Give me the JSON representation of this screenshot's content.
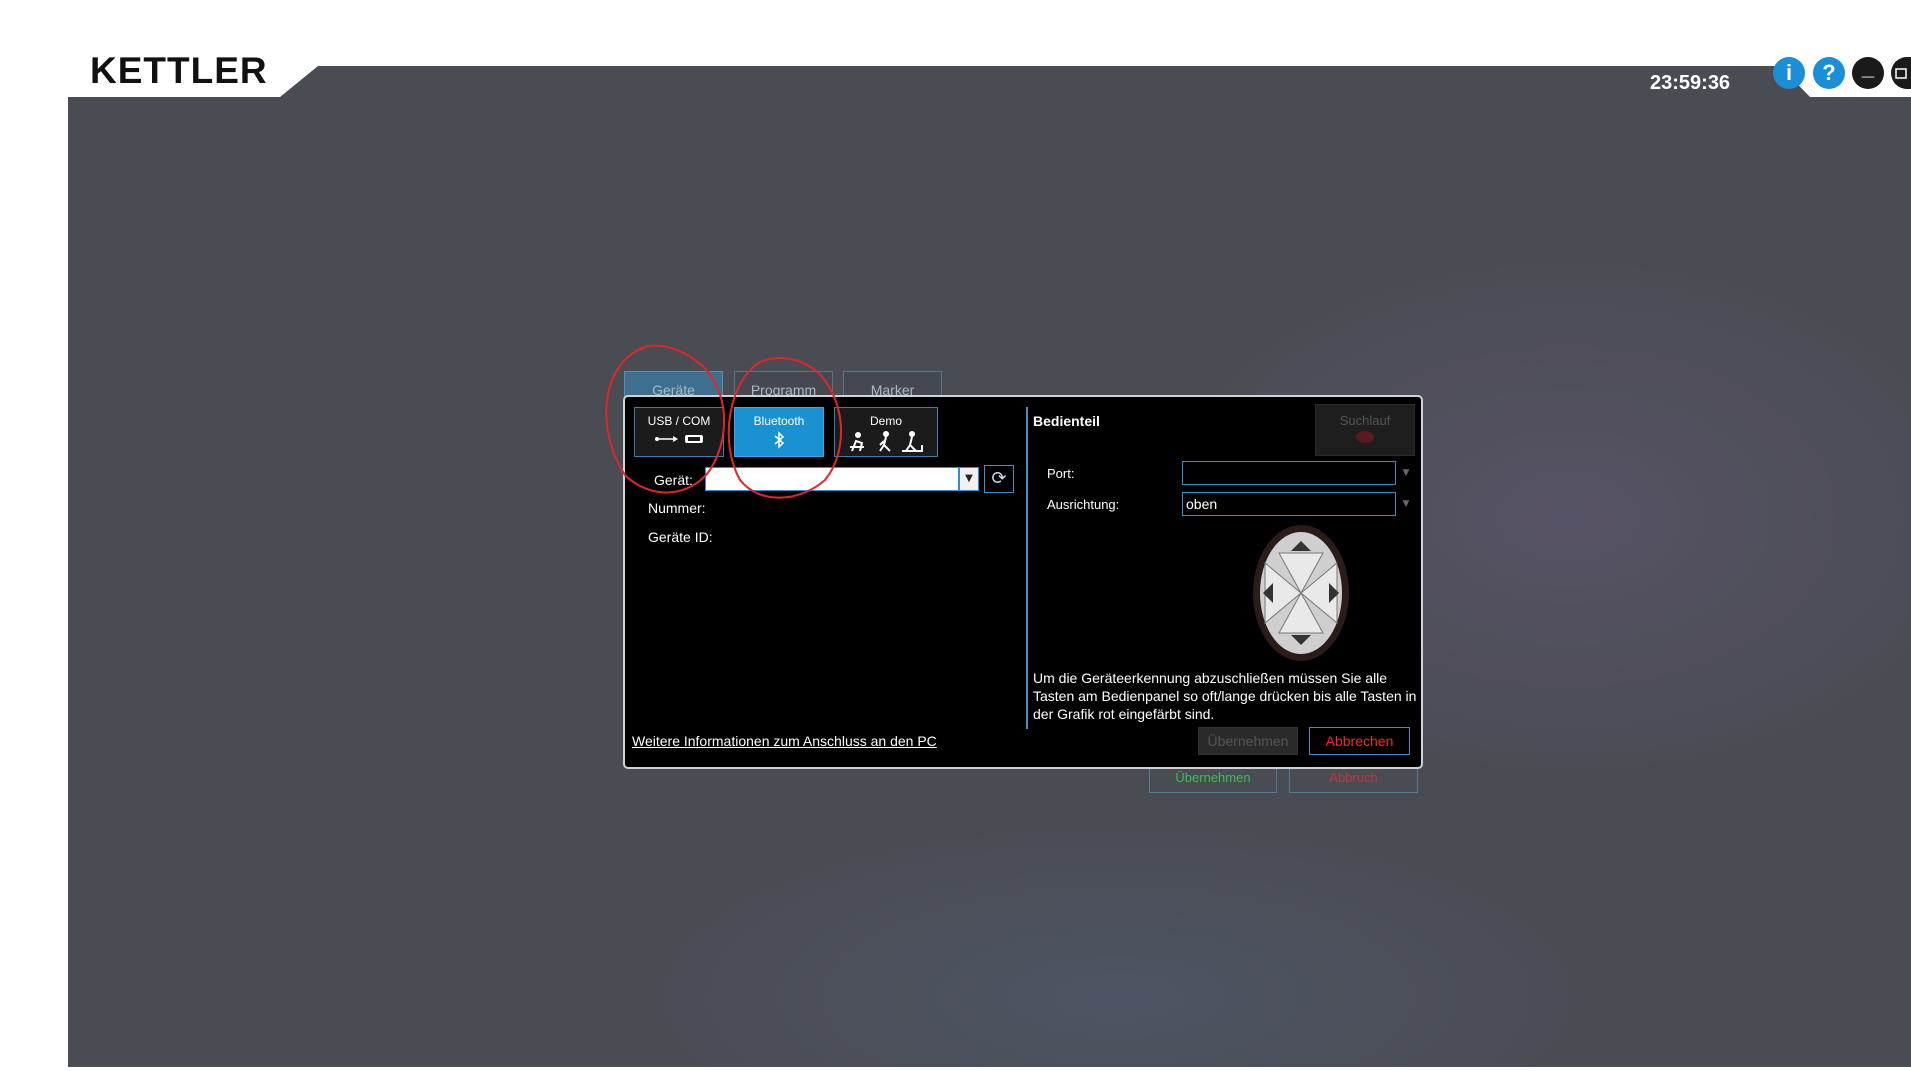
{
  "app": {
    "brand": "KETTLER",
    "clock": "23:59:36",
    "window_buttons": [
      {
        "name": "info-button",
        "label": "i",
        "color": "#1a8fd8"
      },
      {
        "name": "help-button",
        "label": "?",
        "color": "#1a8fd8"
      },
      {
        "name": "minimize-button",
        "label": "_",
        "color": "#1a1a1a"
      }
    ]
  },
  "background_dialog": {
    "tabs": [
      "Geräte",
      "Programm",
      "Marker"
    ],
    "buttons": [
      "Übernehmen",
      "Abbruch"
    ]
  },
  "dialog": {
    "connection_buttons": [
      {
        "label": "USB / COM",
        "icon": "usb-com-icon",
        "glyph": "•⊸ ▭",
        "active": false
      },
      {
        "label": "Bluetooth",
        "icon": "bluetooth-icon",
        "glyph": "ᛒ",
        "active": true
      },
      {
        "label": "Demo",
        "icon": "fitness-devices-icon",
        "glyph": "🚴 🏃 🚶",
        "active": false
      }
    ],
    "device_label": "Gerät:",
    "device_value": "",
    "number_label": "Nummer:",
    "device_id_label": "Geräte ID:",
    "help_link": "Weitere Informationen zum Anschluss an den PC",
    "panel": {
      "title": "Bedienteil",
      "scan_button": "Suchlauf",
      "port_label": "Port:",
      "port_value": "",
      "orientation_label": "Ausrichtung:",
      "orientation_value": "oben",
      "instruction": "Um die Geräteerkennung abzuschließen müssen Sie alle Tasten am Bedienpanel so oft/lange drücken bis alle Tasten in der Grafik rot eingefärbt sind."
    },
    "apply_button": "Übernehmen",
    "cancel_button": "Abbrechen"
  },
  "colors": {
    "accent": "#1a92d1",
    "background": "#4a4c53",
    "cancel_text": "#ff2424",
    "annotation": "#e0262b"
  }
}
